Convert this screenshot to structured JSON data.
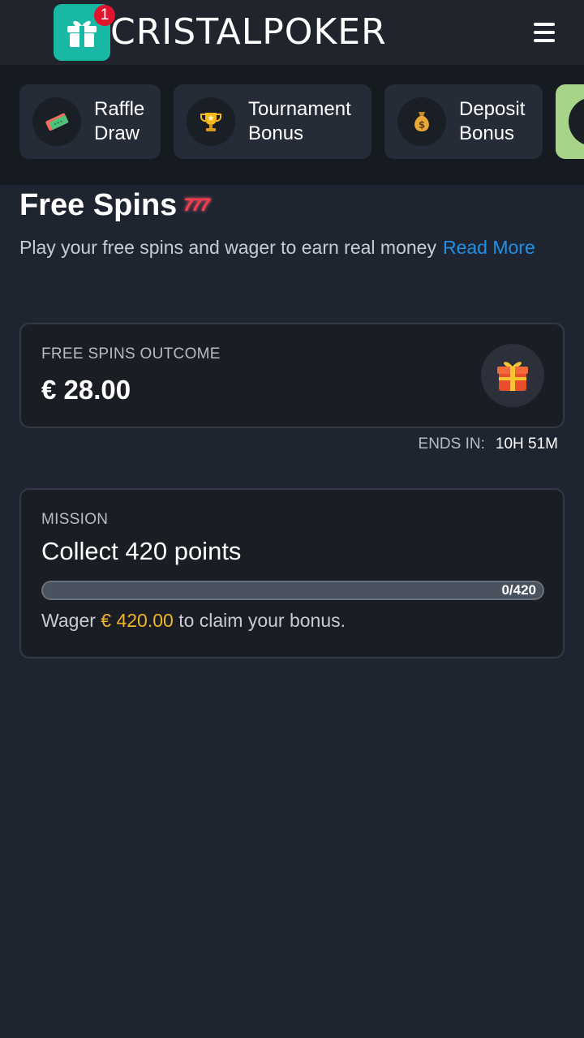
{
  "header": {
    "logo_text": "CRISTALPOKER",
    "notification_count": "1"
  },
  "tabs": [
    {
      "label": "Raffle\nDraw",
      "icon": "ticket-icon"
    },
    {
      "label": "Tournament\nBonus",
      "icon": "trophy-icon"
    },
    {
      "label": "Deposit\nBonus",
      "icon": "money-bag-icon"
    }
  ],
  "page": {
    "title": "Free Spins",
    "title_icon": "777",
    "description": "Play your free spins and wager to earn real money",
    "read_more": "Read More"
  },
  "outcome": {
    "label": "FREE SPINS OUTCOME",
    "amount": "€ 28.00",
    "ends_label": "ENDS IN:",
    "ends_value": "10H 51M"
  },
  "mission": {
    "label": "MISSION",
    "title": "Collect 420 points",
    "progress_text": "0/420",
    "progress_fraction": 0,
    "wager_prefix": "Wager",
    "wager_amount": "€ 420.00",
    "wager_suffix": "to claim your bonus."
  },
  "colors": {
    "accent_teal": "#18b8a4",
    "link_blue": "#1e90e8",
    "amount_gold": "#f0b429",
    "active_tab_green": "#a8d48a"
  }
}
